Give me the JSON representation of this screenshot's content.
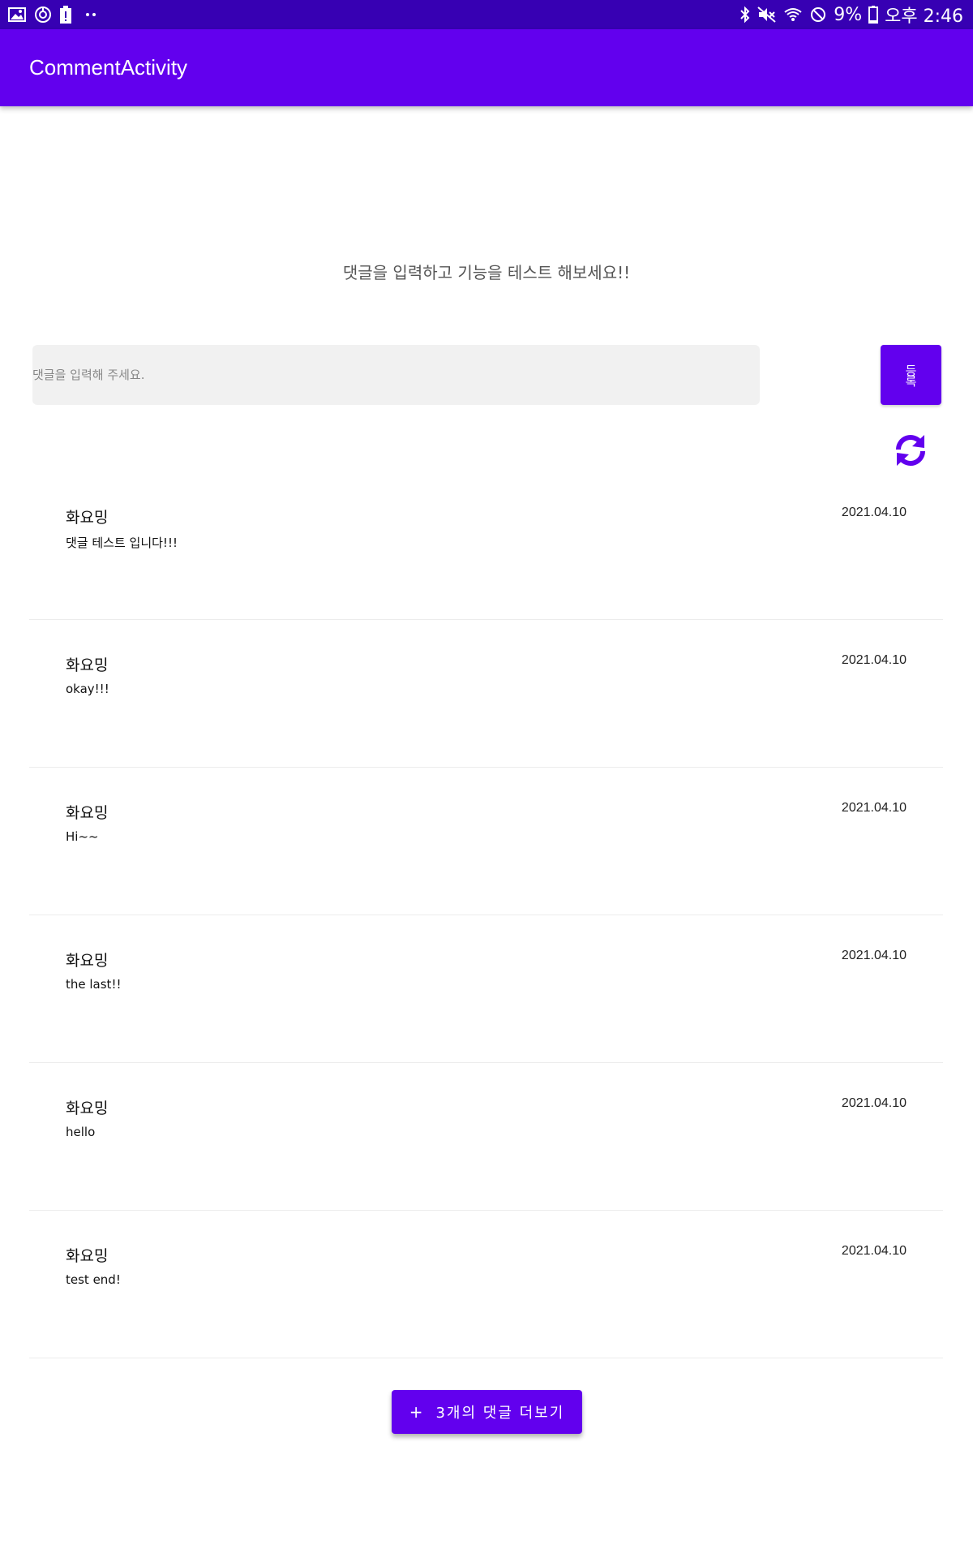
{
  "status_bar": {
    "left_icons": [
      "image-icon",
      "sync-icon",
      "battery-alert-icon",
      "more-dots-icon"
    ],
    "right_icons": [
      "bluetooth-icon",
      "mute-icon",
      "wifi-icon",
      "block-icon",
      "battery-icon"
    ],
    "battery_percent": "9%",
    "time": "오후 2:46"
  },
  "app_bar": {
    "title": "CommentActivity",
    "color": "#6200ee"
  },
  "main": {
    "prompt": "댓글을 입력하고 기능을 테스트 해보세요!!",
    "input_placeholder": "댓글을 입력해 주세요.",
    "input_value": "",
    "register_label": "등록",
    "refresh_icon": "refresh-icon"
  },
  "comments": [
    {
      "author": "화요밍",
      "date": "2021.04.10",
      "text": "댓글 테스트 입니다!!!"
    },
    {
      "author": "화요밍",
      "date": "2021.04.10",
      "text": "okay!!!"
    },
    {
      "author": "화요밍",
      "date": "2021.04.10",
      "text": "Hi~~"
    },
    {
      "author": "화요밍",
      "date": "2021.04.10",
      "text": "the last!!"
    },
    {
      "author": "화요밍",
      "date": "2021.04.10",
      "text": "hello"
    },
    {
      "author": "화요밍",
      "date": "2021.04.10",
      "text": "test end!"
    }
  ],
  "more_button": {
    "icon": "+",
    "label": "3개의 댓글 더보기"
  },
  "colors": {
    "status_bar": "#3700b3",
    "accent": "#6200ee",
    "input_bg": "#f1f1f1"
  }
}
